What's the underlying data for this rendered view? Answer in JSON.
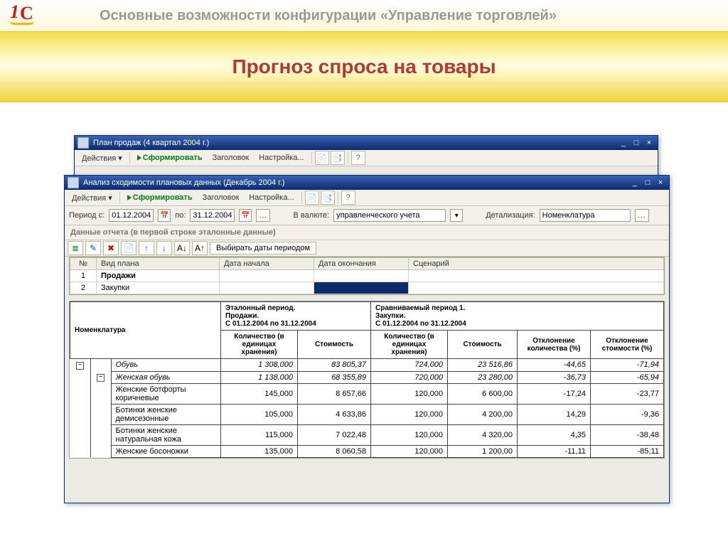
{
  "header": {
    "subtitle": "Основные возможности конфигурации «Управление торговлей»",
    "title": "Прогноз спроса на товары"
  },
  "icons": {
    "minimize": "_",
    "maximize": "□",
    "close": "×",
    "calendar": "📅",
    "dots": "...",
    "help": "?",
    "doc1": "📄",
    "doc2": "📑",
    "tree_minus": "−"
  },
  "back_window": {
    "title": "План продаж (4 квартал 2004 г.)",
    "toolbar": {
      "actions": "Действия ▾",
      "generate": "Сформировать",
      "header_btn": "Заголовок",
      "settings": "Настройка..."
    }
  },
  "front_window": {
    "title": "Анализ сходимости плановых данных (Декабрь 2004 г.)",
    "toolbar": {
      "actions": "Действия ▾",
      "generate": "Сформировать",
      "header_btn": "Заголовок",
      "settings": "Настройка..."
    },
    "filters": {
      "period_from_lbl": "Период с:",
      "period_from": "01.12.2004",
      "period_to_lbl": "по:",
      "period_to": "31.12.2004",
      "currency_lbl": "В валюте:",
      "currency": "управленческого учета",
      "detail_lbl": "Детализация:",
      "detail": "Номенклатура"
    },
    "section_label": "Данные отчета (в первой строке эталонные данные)",
    "period_btn": "Выбирать даты периодом",
    "grid": {
      "cols": {
        "num": "№",
        "plan": "Вид плана",
        "start": "Дата начала",
        "end": "Дата окончания",
        "scenario": "Сценарий"
      },
      "rows": [
        {
          "n": "1",
          "plan": "Продажи"
        },
        {
          "n": "2",
          "plan": "Закупки"
        }
      ]
    },
    "report": {
      "nomenclature_lbl": "Номенклатура",
      "col_group1": "Эталонный период.\nПродажи.\nС 01.12.2004 по 31.12.2004",
      "col_group2": "Сравниваемый период 1.\nЗакупки.\nС 01.12.2004 по 31.12.2004",
      "qty_lbl": "Количество (в единицах хранения)",
      "cost_lbl": "Стоимость",
      "dev_qty_lbl": "Отклонение количества (%)",
      "dev_cost_lbl": "Отклонение стоимости (%)",
      "rows": [
        {
          "name": "Обувь",
          "q1": "1 308,000",
          "c1": "83 805,37",
          "q2": "724,000",
          "c2": "23 516,86",
          "dq": "-44,65",
          "dc": "-71,94",
          "italic": true,
          "tree": 1
        },
        {
          "name": "Женская обувь",
          "q1": "1 138,000",
          "c1": "68 355,89",
          "q2": "720,000",
          "c2": "23 280,00",
          "dq": "-36,73",
          "dc": "-65,94",
          "italic": true,
          "tree": 2
        },
        {
          "name": "Женские ботфорты коричневые",
          "q1": "145,000",
          "c1": "8 657,66",
          "q2": "120,000",
          "c2": "6 600,00",
          "dq": "-17,24",
          "dc": "-23,77"
        },
        {
          "name": "Ботинки женские демисезонные",
          "q1": "105,000",
          "c1": "4 633,86",
          "q2": "120,000",
          "c2": "4 200,00",
          "dq": "14,29",
          "dc": "-9,36"
        },
        {
          "name": "Ботинки женские натуральная кожа",
          "q1": "115,000",
          "c1": "7 022,48",
          "q2": "120,000",
          "c2": "4 320,00",
          "dq": "4,35",
          "dc": "-38,48"
        },
        {
          "name": "Женские босоножки",
          "q1": "135,000",
          "c1": "8 060,58",
          "q2": "120,000",
          "c2": "1 200,00",
          "dq": "-11,11",
          "dc": "-85,11"
        }
      ]
    }
  }
}
